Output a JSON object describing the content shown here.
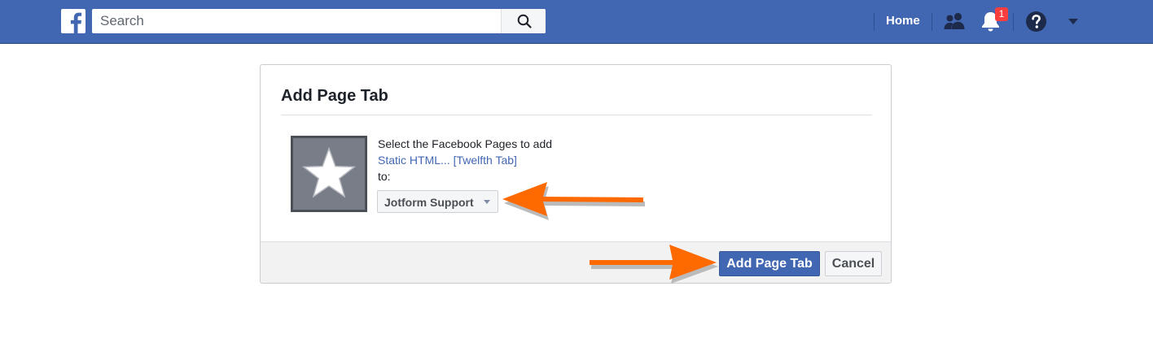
{
  "topbar": {
    "search_placeholder": "Search",
    "home_label": "Home",
    "notification_count": "1"
  },
  "dialog": {
    "title": "Add Page Tab",
    "select_prompt": "Select the Facebook Pages to add",
    "app_name": "Static HTML... [Twelfth Tab]",
    "to_label": "to:",
    "selected_page": "Jotform Support",
    "primary_button": "Add Page Tab",
    "cancel_button": "Cancel"
  },
  "colors": {
    "brand": "#4267b2",
    "annotation_arrow": "#ff6a00",
    "badge": "#fa3e3e"
  },
  "icons": [
    "facebook-logo-icon",
    "search-icon",
    "friends-icon",
    "bell-icon",
    "help-icon",
    "caret-down-icon",
    "star-icon"
  ]
}
